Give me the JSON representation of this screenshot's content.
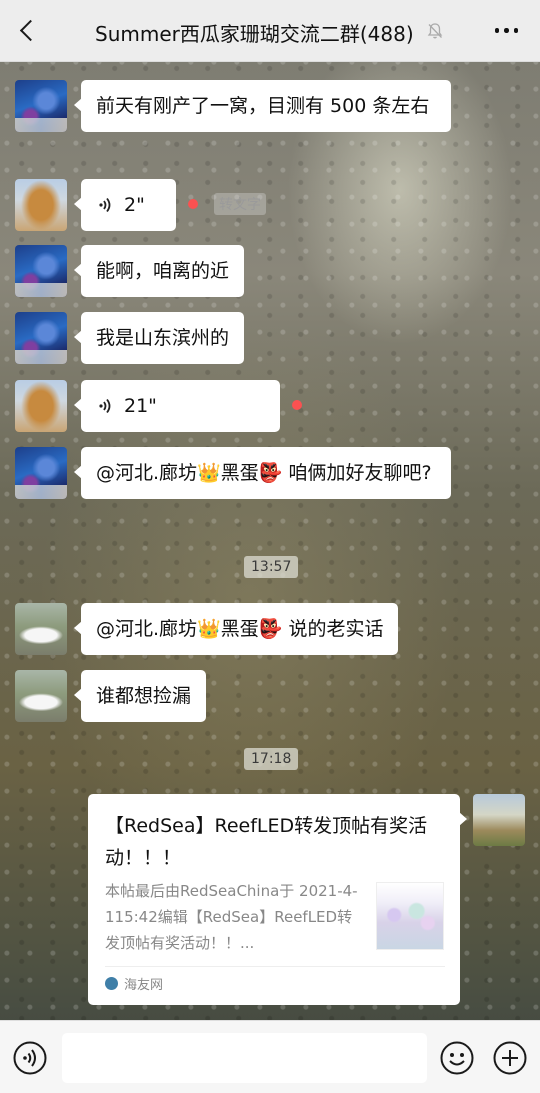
{
  "header": {
    "title": "Summer西瓜家珊瑚交流二群(488)",
    "back_icon": "chevron-left-icon",
    "mute_icon": "bell-off-icon",
    "more_icon": "more-dots-icon"
  },
  "messages": {
    "m1": {
      "text": "前天有刚产了一窝，目测有 500 条左右"
    },
    "m2": {
      "duration": "2\"",
      "convert_label": "转文字"
    },
    "m3": {
      "text": "能啊，咱离的近"
    },
    "m4": {
      "text": "我是山东滨州的"
    },
    "m5": {
      "duration": "21\""
    },
    "m6": {
      "mention": "@河北.廊坊",
      "mention2": "黑蛋",
      "text": "咱俩加好友聊吧?"
    },
    "time1": "13:57",
    "m7": {
      "mention": "@河北.廊坊",
      "mention2": "黑蛋",
      "text": "说的老实话"
    },
    "m8": {
      "text": "谁都想捡漏"
    },
    "time2": "17:18",
    "card": {
      "title": "【RedSea】ReefLED转发顶帖有奖活动！！！",
      "desc": "本帖最后由RedSeaChina于 2021-4-115:42编辑【RedSea】ReefLED转发顶帖有奖活动！！...",
      "source": "海友网"
    }
  },
  "colors": {
    "header_bg": "#ededed",
    "bubble_bg": "#ffffff",
    "unread_dot": "#fa5151"
  },
  "inputbar": {
    "voice_icon": "voice-icon",
    "emoji_icon": "emoji-icon",
    "plus_icon": "plus-icon"
  }
}
